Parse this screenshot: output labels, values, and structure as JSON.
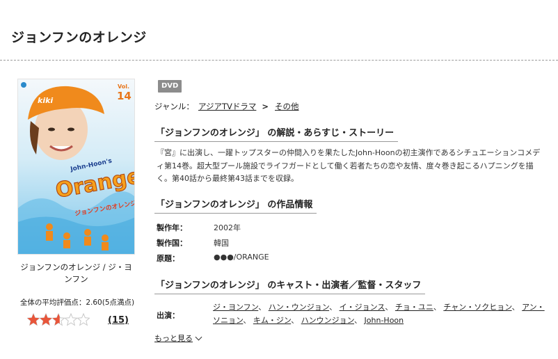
{
  "page": {
    "title": "ジョンフンのオレンジ"
  },
  "cover": {
    "vol_label": "Vol.",
    "vol_number": "14",
    "cap_text": "kiki",
    "logo_top": "John-Hoon's",
    "logo_main": "Orange",
    "logo_sub": "ジョンフンのオレンジ"
  },
  "caption": "ジョンフンのオレンジ / ジ・ヨンフン",
  "rating": {
    "average_text": "全体の平均評価点：2.60(5点満点)",
    "stars": 2.6,
    "max": 5,
    "count_text": "(15)"
  },
  "badge": "DVD",
  "genre": {
    "label": "ジャンル：",
    "primary": "アジアTVドラマ",
    "separator": ">",
    "secondary": "その他"
  },
  "sections": {
    "story_heading": "「ジョンフンのオレンジ」 の解説・あらすじ・ストーリー",
    "info_heading": "「ジョンフンのオレンジ」 の作品情報",
    "cast_heading": "「ジョンフンのオレンジ」 のキャスト・出演者／監督・スタッフ"
  },
  "story": "『宮』に出演し、一躍トップスターの仲間入りを果たしたJohn-Hoonの初主演作であるシチュエーションコメディ第14巻。超大型プール施設でライフガードとして働く若者たちの恋や友情、度々巻き起こるハプニングを描く。第40話から最終第43話までを収録。",
  "info": [
    {
      "key": "製作年：",
      "value": "2002年"
    },
    {
      "key": "製作国：",
      "value": "韓国"
    },
    {
      "key": "原題：",
      "value": "●●●/ORANGE"
    }
  ],
  "cast": {
    "label": "出演：",
    "names": [
      "ジ・ヨンフン",
      "ハン・ウンジョン",
      "イ・ジョンス",
      "チョ・ユニ",
      "チャン・ソクヒョン",
      "アン・ソニョン",
      "キム・ジン",
      "ハンウンジョン",
      "John-Hoon"
    ],
    "separator": "、"
  },
  "more": "もっと見る",
  "colors": {
    "star_fill": "#e8553a",
    "star_empty": "#c8c8c8"
  }
}
